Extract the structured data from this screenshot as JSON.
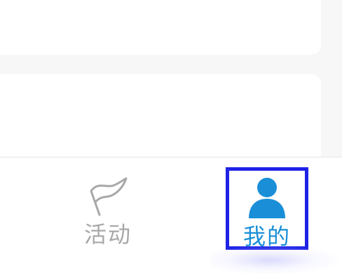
{
  "tabbar": {
    "tabs": [
      {
        "label": "活动",
        "icon": "flag-icon",
        "active": false,
        "color": "#a8a8a8"
      },
      {
        "label": "我的",
        "icon": "user-icon",
        "active": true,
        "color": "#1a8fd8"
      }
    ]
  },
  "colors": {
    "background": "#f7f7f7",
    "card": "#ffffff",
    "active": "#1a8fd8",
    "inactive": "#a8a8a8",
    "highlight_border": "#1e22e6"
  }
}
